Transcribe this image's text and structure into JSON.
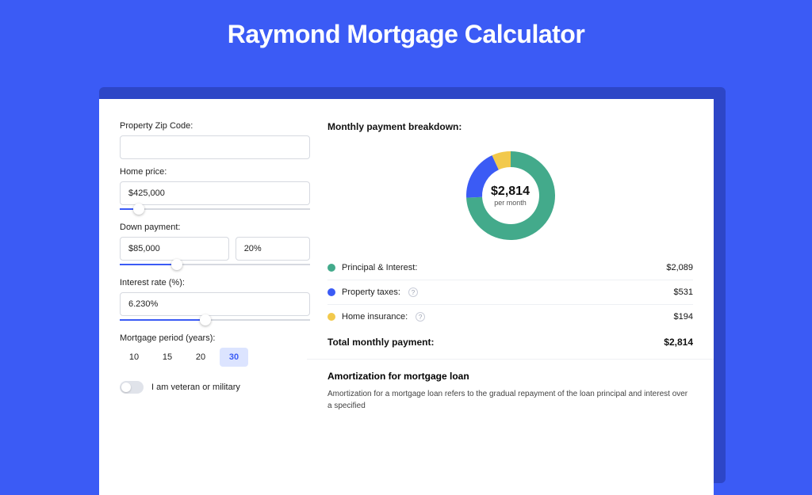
{
  "title": "Raymond Mortgage Calculator",
  "form": {
    "zip_label": "Property Zip Code:",
    "zip_value": "",
    "home_price_label": "Home price:",
    "home_price_value": "$425,000",
    "home_price_slider_pct": 10,
    "down_payment_label": "Down payment:",
    "down_payment_value": "$85,000",
    "down_payment_pct_value": "20%",
    "down_payment_slider_pct": 30,
    "interest_label": "Interest rate (%):",
    "interest_value": "6.230%",
    "interest_slider_pct": 45,
    "period_label": "Mortgage period (years):",
    "periods": [
      "10",
      "15",
      "20",
      "30"
    ],
    "period_active_index": 3,
    "veteran_label": "I am veteran or military",
    "veteran_on": false
  },
  "breakdown": {
    "title": "Monthly payment breakdown:",
    "center_amount": "$2,814",
    "center_sub": "per month",
    "items": [
      {
        "label": "Principal & Interest:",
        "value": "$2,089",
        "color": "g",
        "help": false
      },
      {
        "label": "Property taxes:",
        "value": "$531",
        "color": "b",
        "help": true
      },
      {
        "label": "Home insurance:",
        "value": "$194",
        "color": "y",
        "help": true
      }
    ],
    "total_label": "Total monthly payment:",
    "total_value": "$2,814"
  },
  "amort": {
    "title": "Amortization for mortgage loan",
    "text": "Amortization for a mortgage loan refers to the gradual repayment of the loan principal and interest over a specified"
  },
  "chart_data": {
    "type": "pie",
    "title": "Monthly payment breakdown",
    "series": [
      {
        "name": "Principal & Interest",
        "value": 2089,
        "color": "#43aa8b"
      },
      {
        "name": "Property taxes",
        "value": 531,
        "color": "#3b5bf5"
      },
      {
        "name": "Home insurance",
        "value": 194,
        "color": "#f2c94c"
      }
    ],
    "total": 2814,
    "donut_inner_radius_pct": 62
  }
}
